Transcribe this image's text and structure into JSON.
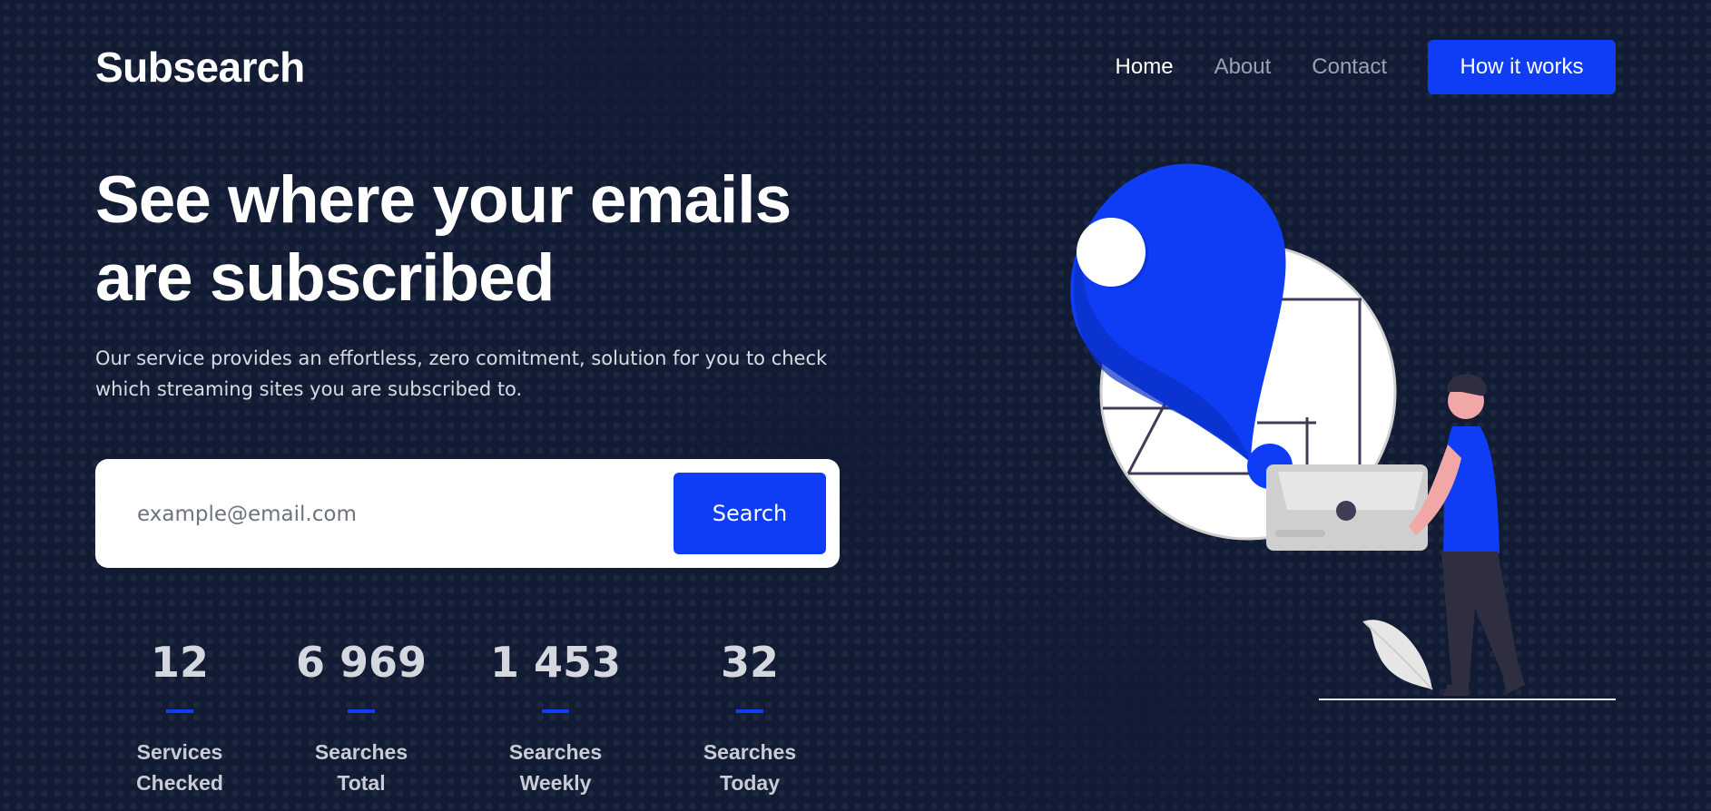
{
  "brand": {
    "name": "Subsearch"
  },
  "nav": {
    "items": [
      {
        "label": "Home",
        "active": true
      },
      {
        "label": "About",
        "active": false
      },
      {
        "label": "Contact",
        "active": false
      }
    ],
    "cta_label": "How it works"
  },
  "hero": {
    "title_line1": "See where your emails",
    "title_line2": "are subscribed",
    "subtitle_line1": "Our service provides an effortless, zero comitment, solution for you to check",
    "subtitle_line2": "which streaming sites you are subscribed to."
  },
  "search": {
    "placeholder": "example@email.com",
    "value": "",
    "button_label": "Search"
  },
  "stats": [
    {
      "value": "12",
      "label_line1": "Services",
      "label_line2": "Checked"
    },
    {
      "value": "6 969",
      "label_line1": "Searches",
      "label_line2": "Total"
    },
    {
      "value": "1 453",
      "label_line1": "Searches",
      "label_line2": "Weekly"
    },
    {
      "value": "32",
      "label_line1": "Searches",
      "label_line2": "Today"
    }
  ],
  "colors": {
    "background": "#111b33",
    "accent": "#0f3df5",
    "text_primary": "#ffffff",
    "text_muted": "#9aa1b0"
  },
  "icons": {
    "illustration": "location-pin-map-person-illustration"
  }
}
